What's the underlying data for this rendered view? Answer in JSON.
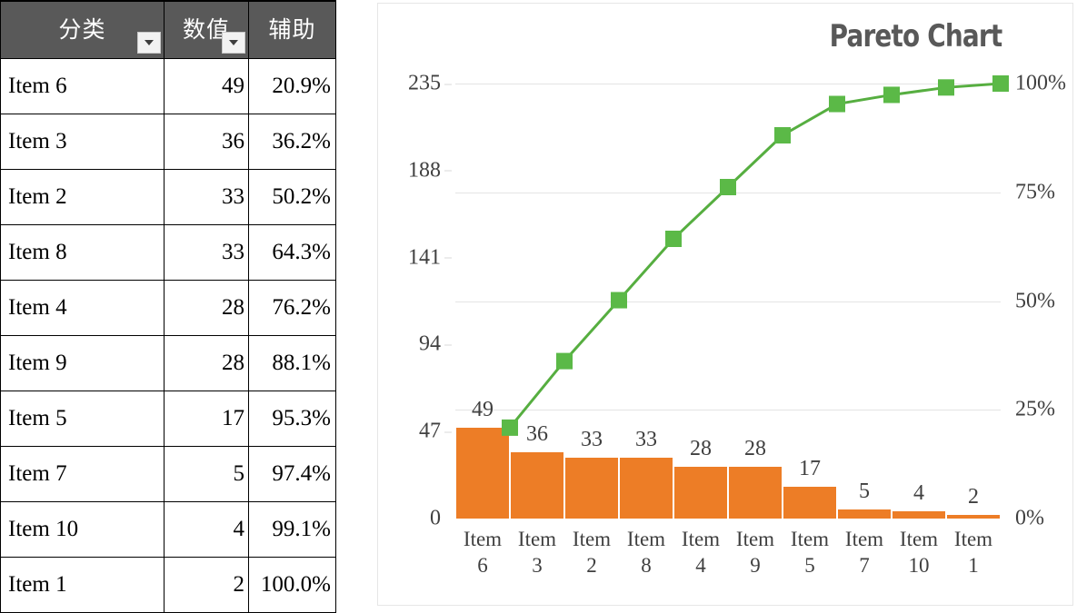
{
  "table": {
    "headers": [
      {
        "label": "分类",
        "has_filter": true
      },
      {
        "label": "数值",
        "has_filter": true
      },
      {
        "label": "辅助",
        "has_filter": false
      }
    ],
    "rows": [
      {
        "category": "Item 6",
        "value": "49",
        "aux": "20.9%"
      },
      {
        "category": "Item 3",
        "value": "36",
        "aux": "36.2%"
      },
      {
        "category": "Item 2",
        "value": "33",
        "aux": "50.2%"
      },
      {
        "category": "Item 8",
        "value": "33",
        "aux": "64.3%"
      },
      {
        "category": "Item 4",
        "value": "28",
        "aux": "76.2%"
      },
      {
        "category": "Item 9",
        "value": "28",
        "aux": "88.1%"
      },
      {
        "category": "Item 5",
        "value": "17",
        "aux": "95.3%"
      },
      {
        "category": "Item 7",
        "value": "5",
        "aux": "97.4%"
      },
      {
        "category": "Item 10",
        "value": "4",
        "aux": "99.1%"
      },
      {
        "category": "Item 1",
        "value": "2",
        "aux": "100.0%"
      }
    ]
  },
  "chart": {
    "title": "Pareto Chart",
    "bar_color": "#ED7D26",
    "line_color": "#56AE40",
    "marker_color": "#5BB947",
    "text_color": "#404040"
  },
  "chart_data": {
    "type": "bar",
    "title": "Pareto Chart",
    "xlabel": "",
    "ylabel": "",
    "grid": true,
    "categories": [
      "Item 6",
      "Item 3",
      "Item 2",
      "Item 8",
      "Item 4",
      "Item 9",
      "Item 5",
      "Item 7",
      "Item 10",
      "Item 1"
    ],
    "series": [
      {
        "name": "数值",
        "type": "bar",
        "axis": "left",
        "values": [
          49,
          36,
          33,
          33,
          28,
          28,
          17,
          5,
          4,
          2
        ],
        "data_labels": [
          "49",
          "36",
          "33",
          "33",
          "28",
          "28",
          "17",
          "5",
          "4",
          "2"
        ],
        "color": "#ED7D26"
      },
      {
        "name": "辅助",
        "type": "line",
        "axis": "right",
        "values": [
          20.9,
          36.2,
          50.2,
          64.3,
          76.2,
          88.1,
          95.3,
          97.4,
          99.1,
          100.0
        ],
        "color": "#56AE40",
        "marker": "square"
      }
    ],
    "left_axis": {
      "ticks": [
        "0",
        "47",
        "94",
        "141",
        "188",
        "235"
      ],
      "tick_values": [
        0,
        47,
        94,
        141,
        188,
        235
      ],
      "ylim": [
        0,
        235
      ]
    },
    "right_axis": {
      "ticks": [
        "0%",
        "25%",
        "50%",
        "75%",
        "100%"
      ],
      "tick_values": [
        0,
        25,
        50,
        75,
        100
      ],
      "ylim": [
        0,
        100
      ]
    }
  }
}
